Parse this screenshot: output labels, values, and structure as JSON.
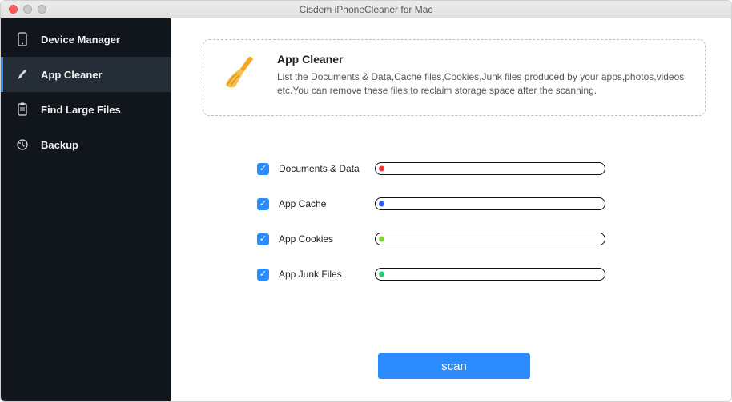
{
  "window": {
    "title": "Cisdem iPhoneCleaner for Mac"
  },
  "sidebar": {
    "items": [
      {
        "label": "Device Manager",
        "active": false
      },
      {
        "label": "App Cleaner",
        "active": true
      },
      {
        "label": "Find Large Files",
        "active": false
      },
      {
        "label": "Backup",
        "active": false
      }
    ]
  },
  "infobox": {
    "title": "App Cleaner",
    "desc": "List the Documents & Data,Cache files,Cookies,Junk files produced by your apps,photos,videos etc.You can remove these files to reclaim storage space after the scanning."
  },
  "categories": [
    {
      "label": "Documents & Data",
      "checked": true,
      "dot_color": "#ff3131"
    },
    {
      "label": "App Cache",
      "checked": true,
      "dot_color": "#2b5fff"
    },
    {
      "label": "App Cookies",
      "checked": true,
      "dot_color": "#7fd62b"
    },
    {
      "label": "App Junk Files",
      "checked": true,
      "dot_color": "#1fc97a"
    }
  ],
  "actions": {
    "scan_label": "scan"
  }
}
